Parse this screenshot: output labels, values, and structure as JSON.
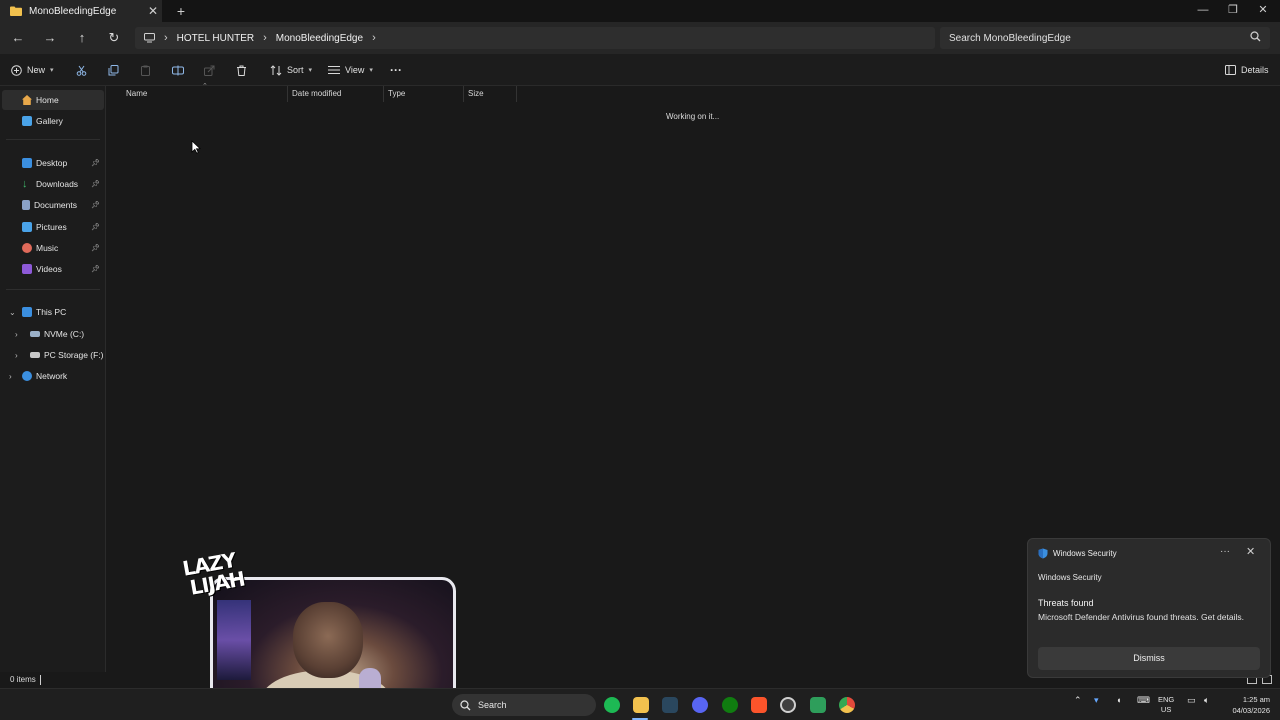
{
  "window": {
    "tab_title": "MonoBleedingEdge",
    "tab_close": "✕",
    "new_tab": "+",
    "minimize": "—",
    "maximize": "❐",
    "close": "✕"
  },
  "nav": {
    "breadcrumb": [
      "HOTEL HUNTER",
      "MonoBleedingEdge"
    ],
    "search_placeholder": "Search MonoBleedingEdge"
  },
  "toolbar": {
    "new_label": "New",
    "sort_label": "Sort",
    "view_label": "View",
    "more_label": "···",
    "details_label": "Details"
  },
  "sidebar": {
    "top_items": [
      {
        "label": "Home",
        "icon": "home-icon",
        "color": "#e8a84a"
      },
      {
        "label": "Gallery",
        "icon": "gallery-icon",
        "color": "#4aa3e8"
      }
    ],
    "quick_access": [
      {
        "label": "Desktop",
        "icon": "desktop-icon",
        "color": "#3b8fe0"
      },
      {
        "label": "Downloads",
        "icon": "downloads-icon",
        "color": "#3fb86a"
      },
      {
        "label": "Documents",
        "icon": "documents-icon",
        "color": "#8aa2c8"
      },
      {
        "label": "Pictures",
        "icon": "pictures-icon",
        "color": "#4aa3e8"
      },
      {
        "label": "Music",
        "icon": "music-icon",
        "color": "#e06a5a"
      },
      {
        "label": "Videos",
        "icon": "videos-icon",
        "color": "#8e5ad8"
      }
    ],
    "this_pc": {
      "label": "This PC",
      "color": "#3b8fe0"
    },
    "drives": [
      {
        "label": "NVMe (C:)",
        "icon": "drive-icon",
        "color": "#9ab0c8"
      },
      {
        "label": "PC Storage (F:)",
        "icon": "drive-icon",
        "color": "#c8c8c8"
      }
    ],
    "network": {
      "label": "Network",
      "color": "#3b8fe0"
    }
  },
  "columns": {
    "name": "Name",
    "date_modified": "Date modified",
    "type": "Type",
    "size": "Size"
  },
  "content": {
    "loading_text": "Working on it..."
  },
  "status": {
    "item_count": "0 items"
  },
  "toast": {
    "header": "Windows Security",
    "app_name": "Windows Security",
    "title": "Threats found",
    "body": "Microsoft Defender Antivirus found threats. Get details.",
    "dismiss_label": "Dismiss",
    "more_label": "···",
    "close_label": "✕"
  },
  "overlay": {
    "logo_line1": "LAZY",
    "logo_line2": "LIJAH"
  },
  "taskbar": {
    "search_label": "Search",
    "apps": [
      {
        "name": "spotify-icon",
        "color": "#1db954"
      },
      {
        "name": "file-explorer-icon",
        "color": "#f2c14e"
      },
      {
        "name": "steam-icon",
        "color": "#2a475e"
      },
      {
        "name": "discord-icon",
        "color": "#5865f2"
      },
      {
        "name": "xbox-icon",
        "color": "#107c10"
      },
      {
        "name": "brave-icon",
        "color": "#fb542b"
      },
      {
        "name": "obs-icon",
        "color": "#404040"
      },
      {
        "name": "spreadsheet-icon",
        "color": "#2e9e5b"
      },
      {
        "name": "chrome-icon",
        "color": "#e0a030"
      }
    ],
    "lang_line1": "ENG",
    "lang_line2": "US",
    "time": "1:25 am",
    "date": "04/03/2026"
  }
}
